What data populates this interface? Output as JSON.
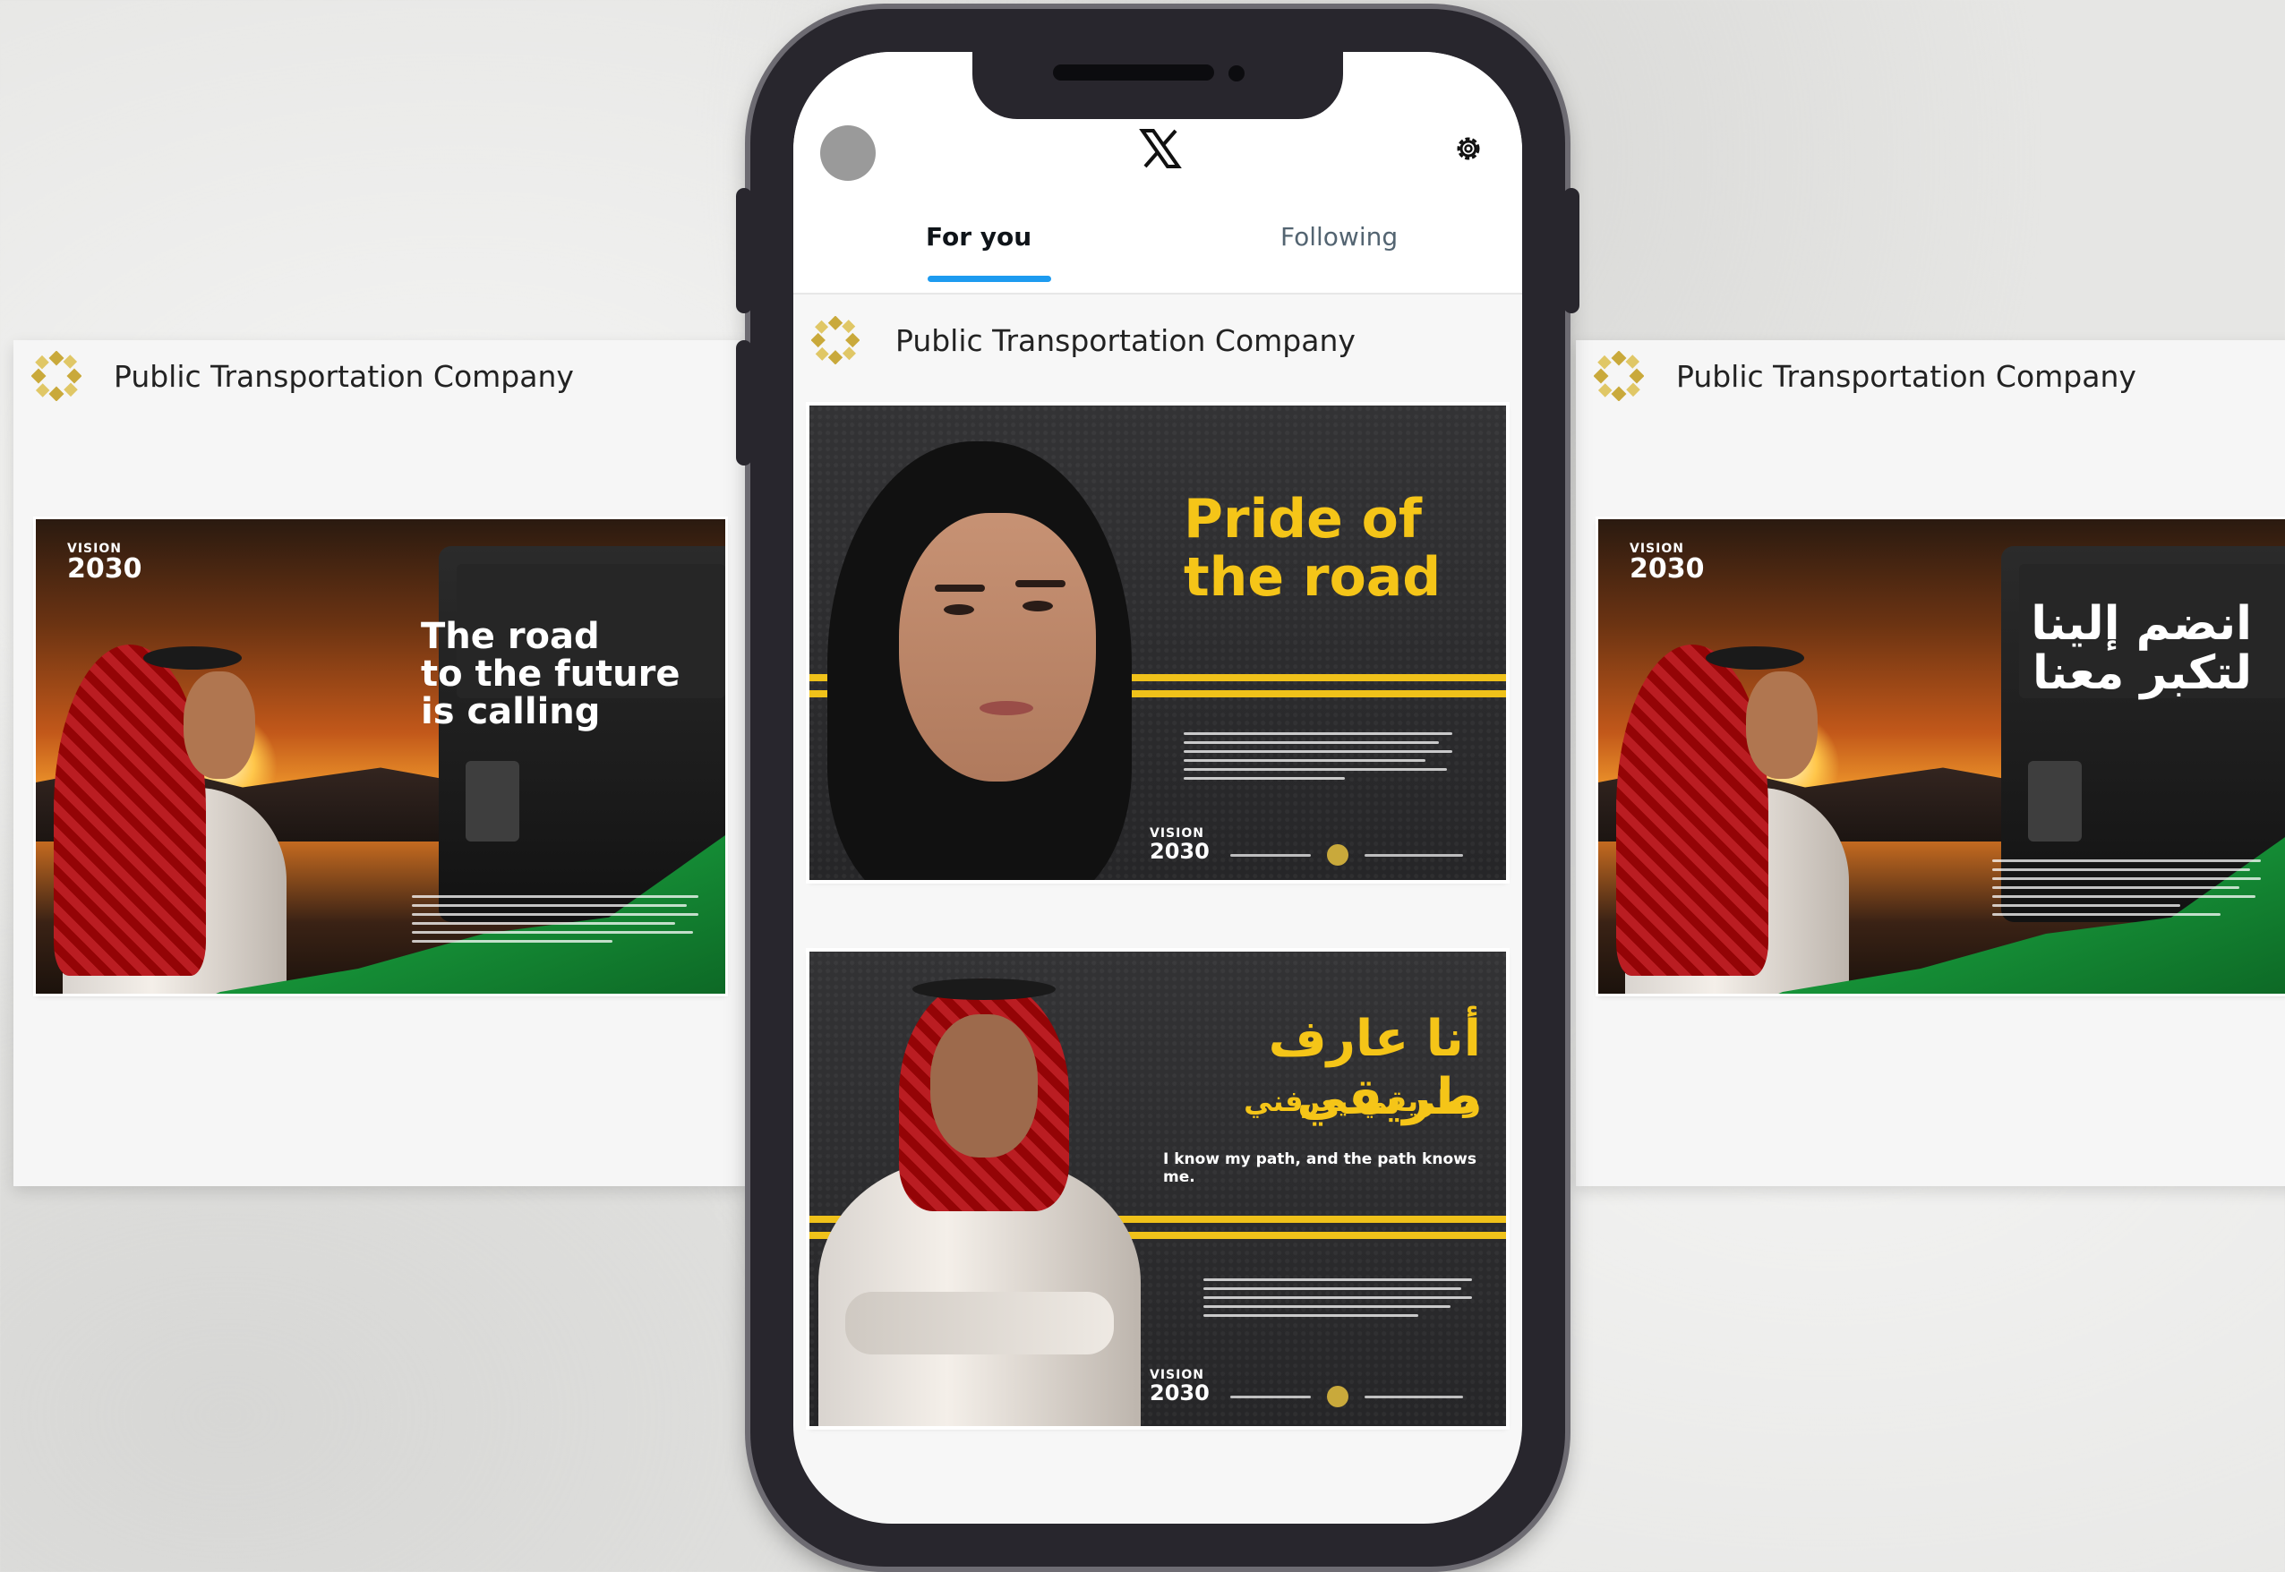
{
  "brand_name": "Public Transportation Company",
  "left_post": {
    "account": "Public Transportation Company",
    "ad": {
      "vision_top": "VISION",
      "vision_year": "2030",
      "headline": [
        "The road",
        "to the future",
        "is calling"
      ]
    }
  },
  "right_post": {
    "account": "Public Transportation Company",
    "ad": {
      "vision_top": "VISION",
      "vision_year": "2030",
      "headline": [
        "انضم إلينا",
        "لتكبر معنا"
      ]
    }
  },
  "phone": {
    "app_logo": "x-logo",
    "tabs": [
      {
        "label": "For you",
        "active": true
      },
      {
        "label": "Following",
        "active": false
      }
    ],
    "post": {
      "account": "Public Transportation Company",
      "ad1": {
        "headline": [
          "Pride of",
          "the road"
        ],
        "vision_top": "VISION",
        "vision_year": "2030"
      },
      "ad2": {
        "headline_ar": "أنا عارف طريقي",
        "subheadline_ar": "وطريقي يعرفني",
        "tagline": "I know my path, and the path knows me.",
        "vision_top": "VISION",
        "vision_year": "2030"
      }
    }
  },
  "colors": {
    "accent_blue": "#1d9bf0",
    "road_yellow": "#f5c518",
    "flag_green": "#17973a",
    "phone_frame": "#28262d"
  }
}
